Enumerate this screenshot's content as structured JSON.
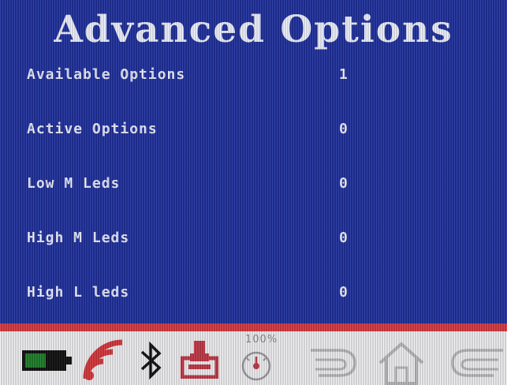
{
  "screen": {
    "title": "Advanced Options"
  },
  "options": [
    {
      "label": "Available Options",
      "value": "1"
    },
    {
      "label": "Active Options",
      "value": "0"
    },
    {
      "label": "Low M Leds",
      "value": "0"
    },
    {
      "label": "High M Leds",
      "value": "0"
    },
    {
      "label": "High L leds",
      "value": "0"
    }
  ],
  "toolbar": {
    "zoom_text": "100%",
    "icons": [
      "battery-icon",
      "signal-icon",
      "bluetooth-icon",
      "hand-push-button-icon",
      "gauge-icon",
      "back-arrow-icon",
      "home-icon",
      "forward-arrow-icon"
    ]
  },
  "colors": {
    "background": "#21329f",
    "text": "#eef0ff",
    "accent_red": "#d93b42",
    "toolbar_bg": "#f1f0f2"
  }
}
